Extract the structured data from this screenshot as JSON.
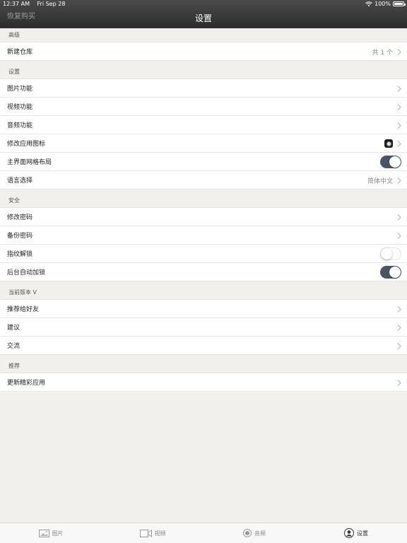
{
  "status_bar": {
    "time": "12:37 AM",
    "date": "Fri Sep 28",
    "battery": "100%"
  },
  "nav": {
    "left_link": "恢复购买",
    "title": "设置"
  },
  "sections": [
    {
      "header": "高级",
      "rows": [
        {
          "label": "新建仓库",
          "value": "共 1 个",
          "accessory": "chevron"
        }
      ]
    },
    {
      "header": "设置",
      "rows": [
        {
          "label": "图片功能",
          "accessory": "chevron"
        },
        {
          "label": "视频功能",
          "accessory": "chevron"
        },
        {
          "label": "音频功能",
          "accessory": "chevron"
        },
        {
          "label": "修改应用图标",
          "accessory": "icon-chevron"
        },
        {
          "label": "主界面网格布局",
          "accessory": "toggle-on"
        },
        {
          "label": "语言选择",
          "value": "简体中文",
          "accessory": "chevron"
        }
      ]
    },
    {
      "header": "安全",
      "rows": [
        {
          "label": "修改密码",
          "accessory": "chevron"
        },
        {
          "label": "备份密码",
          "accessory": "chevron"
        },
        {
          "label": "指纹解锁",
          "accessory": "toggle-off"
        },
        {
          "label": "后台自动加锁",
          "accessory": "toggle-on"
        }
      ]
    },
    {
      "header": "当前版本 V",
      "rows": [
        {
          "label": "推荐给好友",
          "accessory": "chevron"
        },
        {
          "label": "建议",
          "accessory": "chevron"
        },
        {
          "label": "交流",
          "accessory": "chevron"
        }
      ]
    },
    {
      "header": "推荐",
      "rows": [
        {
          "label": "更新精彩应用",
          "accessory": "chevron"
        }
      ]
    }
  ],
  "tabs": [
    {
      "label": "图片",
      "icon": "photo-icon",
      "active": false
    },
    {
      "label": "视频",
      "icon": "video-icon",
      "active": false
    },
    {
      "label": "音频",
      "icon": "audio-icon",
      "active": false
    },
    {
      "label": "设置",
      "icon": "user-icon",
      "active": true
    }
  ],
  "colors": {
    "toggle_on": "#4a5464",
    "background": "#f2f0ec",
    "topbar": "#333333"
  }
}
